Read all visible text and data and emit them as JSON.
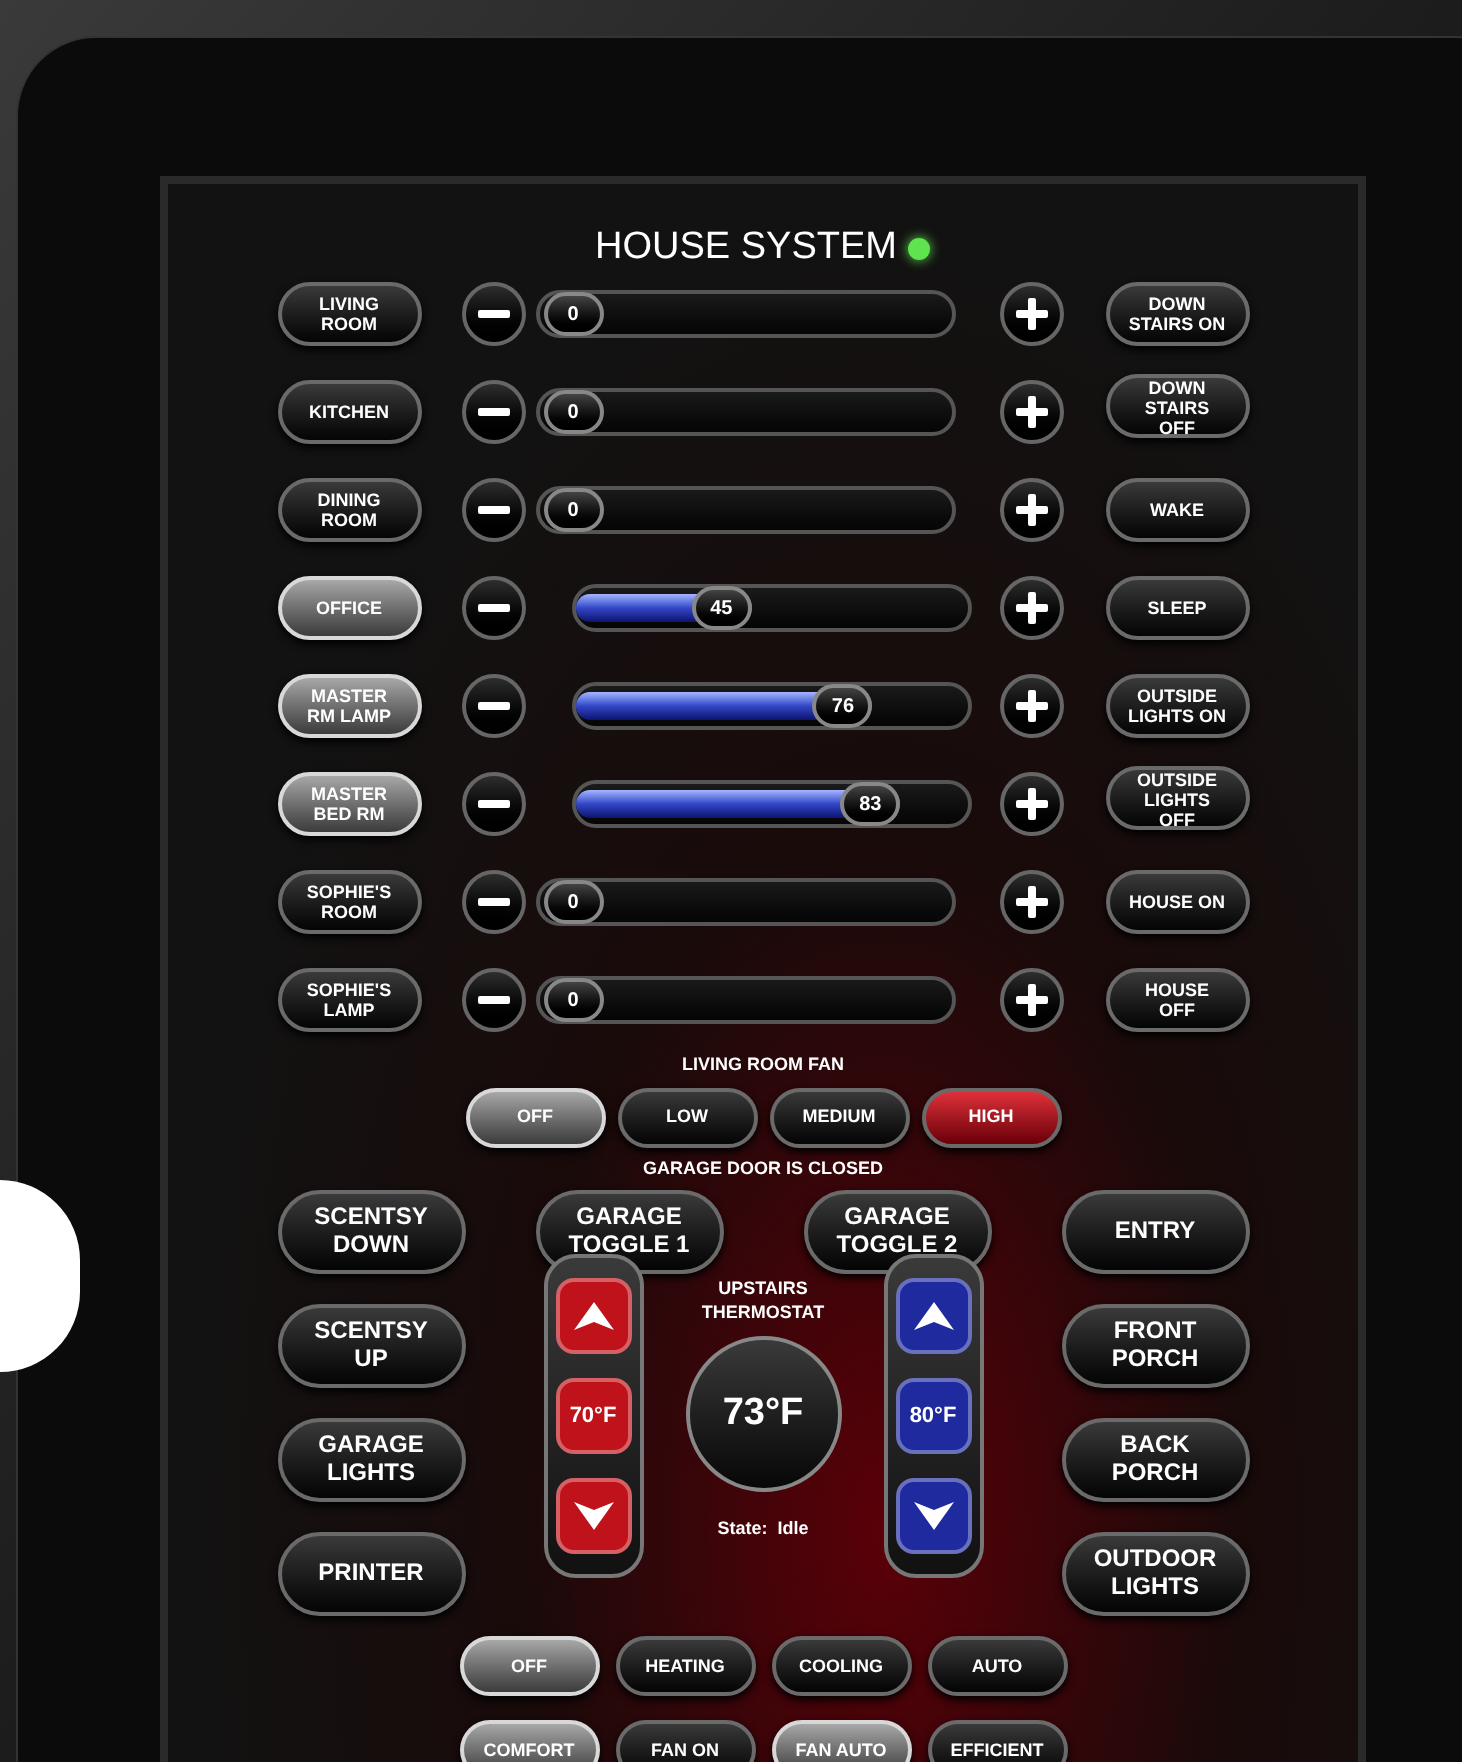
{
  "title": "HOUSE SYSTEM",
  "online": true,
  "dimmers": [
    {
      "room": "LIVING ROOM",
      "selected": false,
      "level": 0,
      "reading": "0",
      "scene": "DOWN STAIRS ON"
    },
    {
      "room": "KITCHEN",
      "selected": false,
      "level": 0,
      "reading": "0",
      "scene": "DOWN STAIRS OFF"
    },
    {
      "room": "DINING ROOM",
      "selected": false,
      "level": 0,
      "reading": "0",
      "scene": "WAKE"
    },
    {
      "room": "OFFICE",
      "selected": true,
      "level": 0.45,
      "reading": "45",
      "scene": "SLEEP"
    },
    {
      "room": "MASTER RM LAMP",
      "selected": true,
      "level": 0.76,
      "reading": "76",
      "scene": "OUTSIDE LIGHTS ON"
    },
    {
      "room": "MASTER BED RM",
      "selected": true,
      "level": 0.83,
      "reading": "83",
      "scene": "OUTSIDE LIGHTS OFF"
    },
    {
      "room": "SOPHIE'S ROOM",
      "selected": false,
      "level": 0,
      "reading": "0",
      "scene": "HOUSE ON"
    },
    {
      "room": "SOPHIE'S LAMP",
      "selected": false,
      "level": 0,
      "reading": "0",
      "scene": "HOUSE OFF"
    }
  ],
  "fan": {
    "label": "LIVING ROOM FAN",
    "options": [
      {
        "label": "OFF",
        "selected": true,
        "on": false
      },
      {
        "label": "LOW",
        "selected": false,
        "on": false
      },
      {
        "label": "MEDIUM",
        "selected": false,
        "on": false
      },
      {
        "label": "HIGH",
        "selected": false,
        "on": true
      }
    ]
  },
  "garage_status": "GARAGE DOOR IS CLOSED",
  "left_buttons": [
    "SCENTSY DOWN",
    "SCENTSY UP",
    "GARAGE LIGHTS",
    "PRINTER"
  ],
  "garage_buttons": [
    "GARAGE TOGGLE 1",
    "GARAGE TOGGLE 2"
  ],
  "right_buttons": [
    "ENTRY",
    "FRONT PORCH",
    "BACK PORCH",
    "OUTDOOR LIGHTS"
  ],
  "thermostat": {
    "label": "UPSTAIRS THERMOSTAT",
    "current": "73°F",
    "state": "State:  Idle",
    "setpoints": [
      {
        "value": "70°F",
        "color": "#c0121b"
      },
      {
        "value": "80°F",
        "color": "#1f2a9e"
      }
    ],
    "modes": [
      {
        "label": "OFF",
        "selected": true
      },
      {
        "label": "HEATING",
        "selected": false
      },
      {
        "label": "COOLING",
        "selected": false
      },
      {
        "label": "AUTO",
        "selected": false
      }
    ],
    "fan_modes": [
      {
        "label": "COMFORT",
        "selected": true
      },
      {
        "label": "FAN ON",
        "selected": false
      },
      {
        "label": "FAN AUTO",
        "selected": true
      },
      {
        "label": "EFFICIENT",
        "selected": false
      }
    ]
  }
}
